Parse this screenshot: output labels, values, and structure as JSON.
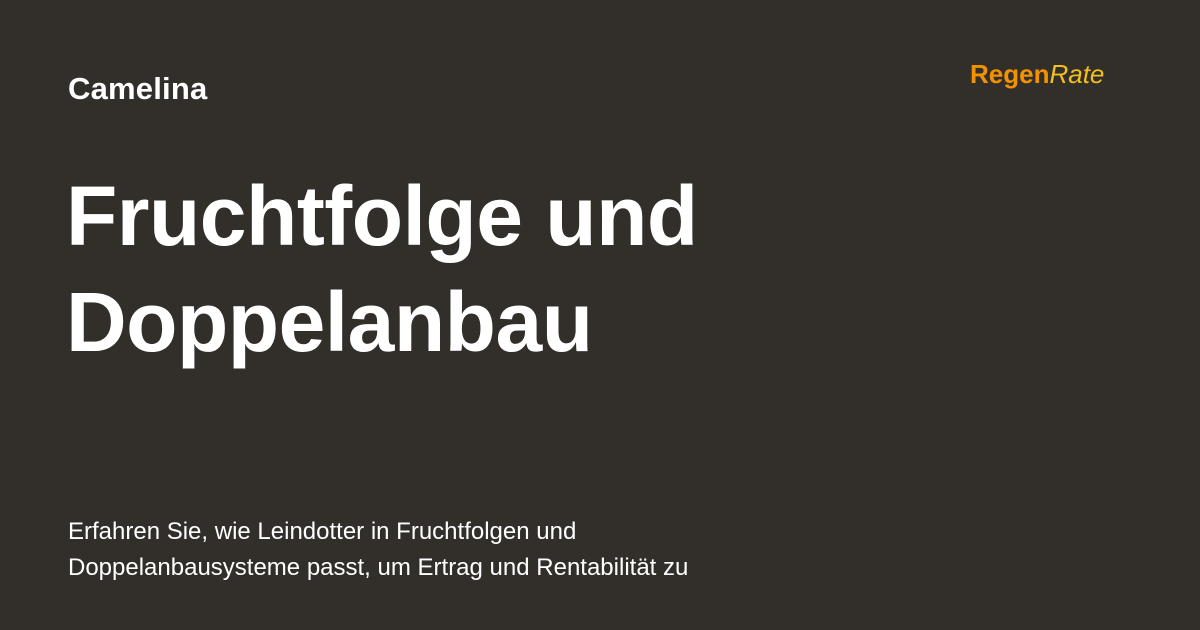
{
  "card": {
    "category": "Camelina",
    "brand": {
      "part1": "Regen",
      "part2": "Rate"
    },
    "headline": {
      "line1": "Fruchtfolge und",
      "line2": "Doppelanbau"
    },
    "description": {
      "line1": "Erfahren Sie, wie Leindotter in Fruchtfolgen und",
      "line2": "Doppelanbausysteme passt, um Ertrag und Rentabilität zu"
    }
  },
  "colors": {
    "background": "#322f2b",
    "text": "#ffffff",
    "brand_regen": "#f39200",
    "brand_rate": "#f2bf1e"
  }
}
